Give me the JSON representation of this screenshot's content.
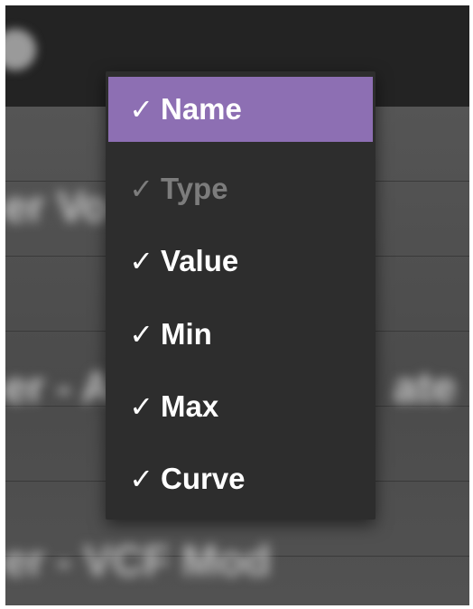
{
  "background": {
    "blurred_rows": [
      "er Vo",
      "er - A",
      "ate",
      "er - VCF Mod"
    ]
  },
  "column_menu": {
    "items": [
      {
        "label": "Name",
        "checked": true,
        "check_glyph": "✓",
        "state": "highlighted"
      },
      {
        "label": "Type",
        "checked": true,
        "check_glyph": "✓",
        "state": "disabled"
      },
      {
        "label": "Value",
        "checked": true,
        "check_glyph": "✓",
        "state": "normal"
      },
      {
        "label": "Min",
        "checked": true,
        "check_glyph": "✓",
        "state": "normal"
      },
      {
        "label": "Max",
        "checked": true,
        "check_glyph": "✓",
        "state": "normal"
      },
      {
        "label": "Curve",
        "checked": true,
        "check_glyph": "✓",
        "state": "normal"
      }
    ]
  },
  "colors": {
    "menu_background": "#2d2d2d",
    "highlight": "#8d6fb3",
    "item_text": "#ffffff",
    "disabled_text": "#7c7c7c"
  }
}
